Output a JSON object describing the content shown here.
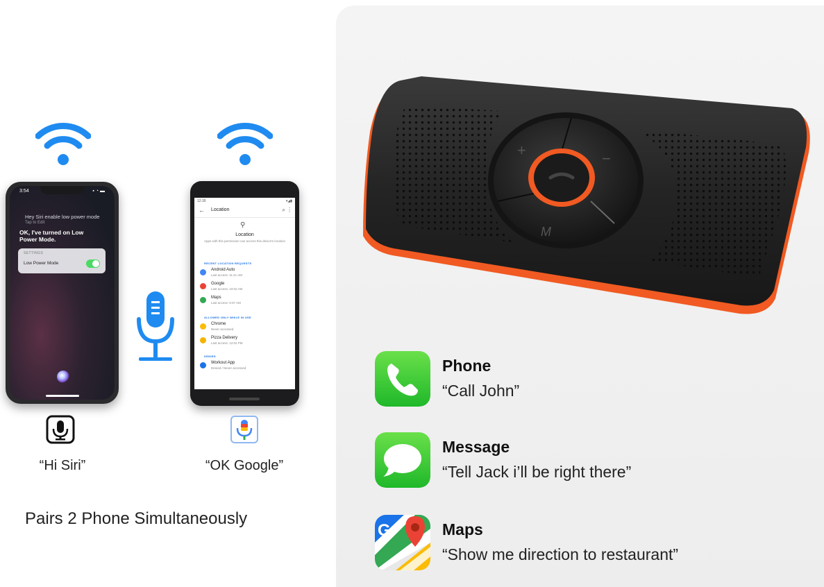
{
  "left": {
    "iphone": {
      "status_time": "3:54",
      "siri_query": "Hey Siri enable low power mode",
      "siri_tap": "Tap to Edit",
      "siri_reply": "OK, I've turned on Low Power Mode.",
      "card_header": "SETTINGS",
      "card_row": "Low Power Mode"
    },
    "android": {
      "status_time": "12:30",
      "toolbar_title": "Location",
      "heading": "Location",
      "description": "Apps with this permission can access this device's location",
      "section_recent": "RECENT LOCATION REQUESTS",
      "section_allowed": "ALLOWED ONLY WHILE IN USE",
      "section_denied": "DENIED",
      "apps": [
        {
          "name": "Android Auto",
          "sub": "Last access: 11:41 AM",
          "color": "#4285f4"
        },
        {
          "name": "Google",
          "sub": "Last access: 10:02 AM",
          "color": "#ea4335"
        },
        {
          "name": "Maps",
          "sub": "Last access: 9:37 AM",
          "color": "#34a853"
        },
        {
          "name": "Chrome",
          "sub": "Never accessed",
          "color": "#fbbc05"
        },
        {
          "name": "Pizza Delivery",
          "sub": "Last access: 12:02 PM",
          "color": "#f4b400"
        },
        {
          "name": "Workout App",
          "sub": "Denied / Never accessed",
          "color": "#1a73e8"
        }
      ]
    },
    "phrases": {
      "siri": "“Hi Siri”",
      "google": "“OK Google”"
    },
    "pair_text": "Pairs 2 Phone Simultaneously",
    "colors": {
      "wifi": "#1f8bf0",
      "mic": "#1f8bf0"
    }
  },
  "speaker": {
    "buttons": {
      "plus": "+",
      "minus": "−",
      "mode": "M"
    },
    "colors": {
      "body": "#1f1f1f",
      "accent": "#f15a22"
    }
  },
  "apps": [
    {
      "title": "Phone",
      "command": "“Call John”",
      "icon": "phone-icon"
    },
    {
      "title": "Message",
      "command": "“Tell Jack i’ll be right there”",
      "icon": "message-icon"
    },
    {
      "title": "Maps",
      "command": "“Show me direction to restaurant”",
      "icon": "maps-icon"
    }
  ],
  "maps_icon_letter": "G"
}
